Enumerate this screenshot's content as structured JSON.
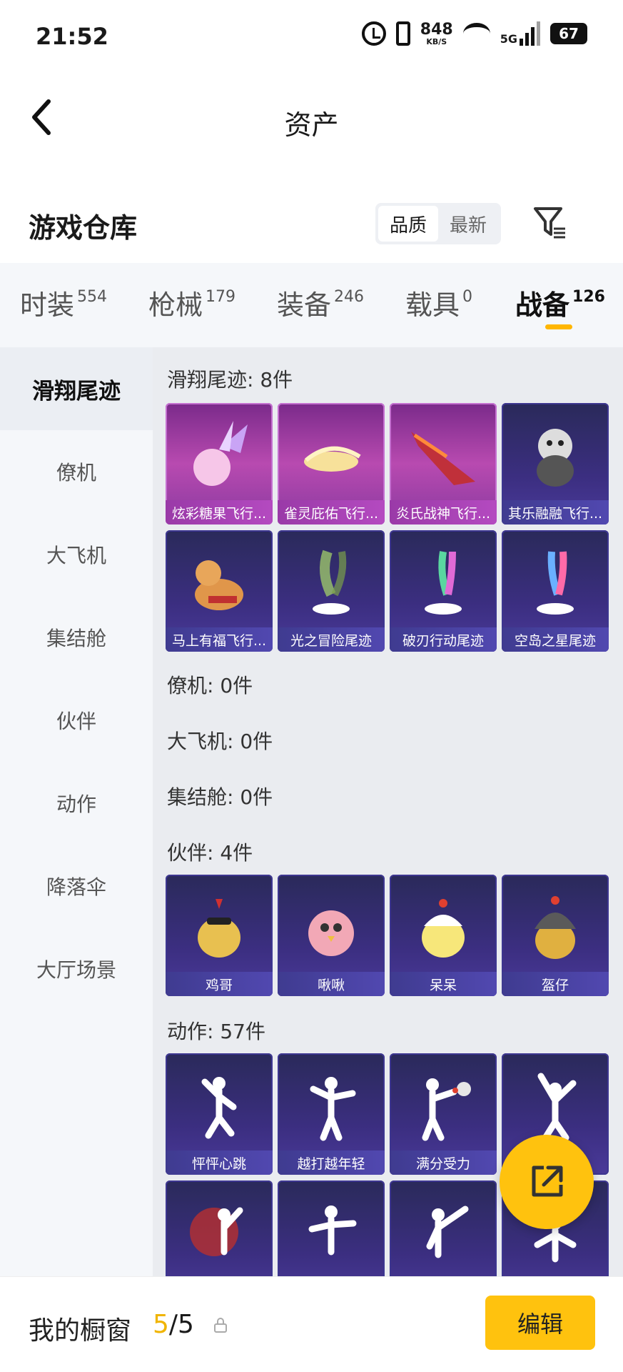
{
  "status_bar": {
    "time": "21:52",
    "net_speed": "848",
    "net_unit": "KB/S",
    "network": "5G",
    "battery": "67"
  },
  "header": {
    "title": "资产"
  },
  "warehouse": {
    "title": "游戏仓库",
    "sort_options": [
      "品质",
      "最新"
    ],
    "sort_active": "品质"
  },
  "tabs": [
    {
      "label": "时装",
      "count": "554"
    },
    {
      "label": "枪械",
      "count": "179"
    },
    {
      "label": "装备",
      "count": "246"
    },
    {
      "label": "载具",
      "count": "0"
    },
    {
      "label": "战备",
      "count": "126",
      "active": true
    }
  ],
  "sidebar": [
    "滑翔尾迹",
    "僚机",
    "大飞机",
    "集结舱",
    "伙伴",
    "动作",
    "降落伞",
    "大厅场景"
  ],
  "groups": {
    "glide": {
      "title": "滑翔尾迹: 8件",
      "items": [
        "炫彩糖果飞行...",
        "雀灵庇佑飞行...",
        "炎氏战神飞行...",
        "其乐融融飞行...",
        "马上有福飞行...",
        "光之冒险尾迹",
        "破刃行动尾迹",
        "空岛之星尾迹"
      ]
    },
    "wingman": {
      "title": "僚机: 0件"
    },
    "plane": {
      "title": "大飞机: 0件"
    },
    "pod": {
      "title": "集结舱: 0件"
    },
    "partner": {
      "title": "伙伴: 4件",
      "items": [
        "鸡哥",
        "啾啾",
        "呆呆",
        "盔仔"
      ]
    },
    "emote": {
      "title": "动作: 57件",
      "items": [
        "怦怦心跳",
        "越打越年轻",
        "满分受力"
      ]
    }
  },
  "bottom": {
    "showcase_label": "我的橱窗",
    "showcase_current": "5",
    "showcase_total": "/5",
    "edit_label": "编辑"
  },
  "colors": {
    "accent": "#ffc20e",
    "card_purple": "#b84ab0",
    "card_blue": "#3b2e80"
  }
}
